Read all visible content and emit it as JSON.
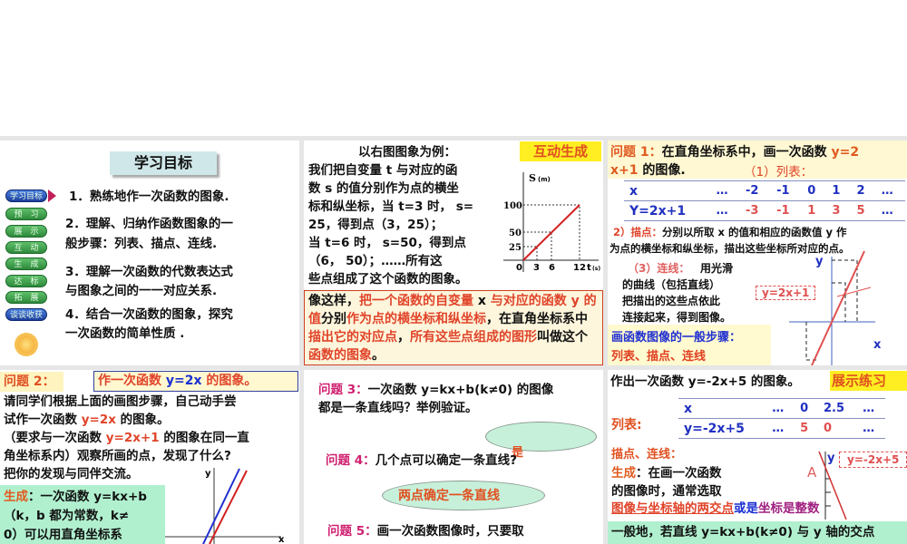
{
  "p1": {
    "title": "学习目标",
    "nav": [
      "学习目标",
      "预　习",
      "展　示",
      "互　动",
      "生　成",
      "达　标",
      "拓　展",
      "谈谈收获"
    ],
    "items": [
      "1．熟练地作一次函数的图象.",
      "2．理解、归纳作函数图象的一",
      "般步骤：列表、描点、连线.",
      "3．理解一次函数的代数表达式",
      "与图象之间的一一对应关系.",
      "4．结合一次函数的图象，探究",
      "一次函数的简单性质 ."
    ],
    "sun_icon": "sun-icon"
  },
  "p2": {
    "badge": "互动生成",
    "lines": [
      "以右图图象为例：",
      "我们把自变量 t 与对应的函",
      "数 s 的值分别作为点的横坐",
      "标和纵坐标，当 t=3 时， s=",
      "25，得到点（3，25）；",
      "当 t=6 时， s=50，得到点",
      "（6， 50）；……所有这",
      "些点组成了这个函数的图象。"
    ],
    "chart": {
      "ylabel": "S",
      "yunit": "(m)",
      "xlabel": "t",
      "xunit": "(s)",
      "origin": "0",
      "yticks": [
        "100",
        "50",
        "25"
      ],
      "xticks": [
        "3",
        "6",
        "12"
      ]
    },
    "box": {
      "s1": "像这样，",
      "s2": "把一个函数的自变量",
      "s3": " x ",
      "s4": "与对应的函",
      "s5": "数 y 的值",
      "s6": "分别",
      "s7": "作为点的横坐标和纵坐标",
      "s8": "，在",
      "s9": "直角坐标系中",
      "s10": "描出它的对应点",
      "s11": "，",
      "s12": "所有这些点",
      "s13": "组成的图形",
      "s14": "叫做这个",
      "s15": "函数的图象",
      "s16": "。"
    }
  },
  "p3": {
    "q": "问题 1：",
    "q_text": "在直角坐标系中，画一次函数 ",
    "q_fn1": "y=2",
    "q_fn2": "x+1",
    "q_end": " 的图像.",
    "step1": "（1）列表：",
    "table": {
      "x": [
        "x",
        "…",
        "-2",
        "-1",
        "0",
        "1",
        "2",
        "…"
      ],
      "y": [
        "Y=2x+1",
        "…",
        "-3",
        "-1",
        "1",
        "3",
        "5",
        "…"
      ]
    },
    "step2_label": "2）描点：",
    "step2_a": "分别以所取 x 的值和相应的函数值 y 作",
    "step2_b": "为点的横坐标和纵坐标，描出这些坐标所对应的点。",
    "step3_label": "（3）连线：",
    "step3": [
      "用光滑",
      "的曲线（包括直线）",
      "把描出的这些点依此",
      "连接起来，得到图像。"
    ],
    "label": "y=2x+1",
    "axis_y": "y",
    "axis_x": "x",
    "summary1": "画函数图像的一般步骤：",
    "summary2": "列表、描点、连线"
  },
  "p4": {
    "q": "问题 2：",
    "task1": "作一次函数 ",
    "task_fn": "y=2x",
    "task2": " 的图象。",
    "lines": [
      "请同学们根据上面的画图步骤，自己动手尝"
    ],
    "l2a": "试作一次函数 ",
    "l2b": "y=2x",
    "l2c": " 的图象。",
    "l3a": "（要求与一次函数 ",
    "l3b": "y=2x+1",
    "l3c": " 的图象在同一直",
    "l4": "角坐标系内）观察所画的点，发现了什么?",
    "l5": "把你的发现与同伴交流。",
    "gen_label": "生成",
    "gen": [
      "：一次函数 y=kx+b",
      "（k，b 都为常数，k≠",
      "0）可以用直角坐标系"
    ],
    "axis_y": "y",
    "axis_x": "x"
  },
  "p5": {
    "q3": "问题 3：",
    "q3_text": "一次函数 y=kx+b(k≠0) 的图像",
    "q3_text2": "都是一条直线吗？举例验证。",
    "a3": "是",
    "q4": "问题 4：",
    "q4_text": "几个点可以确定一条直线?",
    "a4": "两点确定一条直线",
    "q5": "问题 5：",
    "q5_text": "画一次函数图像时，只要取"
  },
  "p6": {
    "title": "作出一次函数 y=-2x+5 的图象。",
    "badge": "展示练习",
    "list_label": "列表:",
    "table": {
      "x": [
        "x",
        "…",
        "0",
        "2.5",
        "…"
      ],
      "y": [
        "y=-2x+5",
        "…",
        "5",
        "0",
        "…"
      ]
    },
    "plot": "描点、连线：",
    "gen_label": "生成",
    "gen1": "：在画一次函数",
    "gen2": "的图像时，通常选取",
    "gen3a": "图像与坐标轴的两交点",
    "gen3b": "或是",
    "gen3c": "坐标是整数",
    "point": "A",
    "axis_y": "y",
    "fn_label": "y=-2x+5",
    "bottom": "一般地，若直线 y=kx+b(k≠0) 与 y 轴的交点"
  }
}
